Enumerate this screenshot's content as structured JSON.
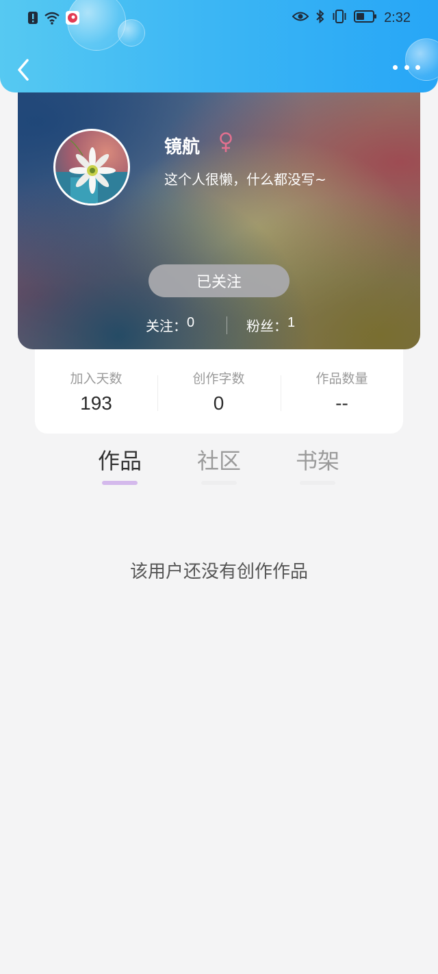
{
  "status_bar": {
    "time": "2:32",
    "icons_left": [
      "alert-icon",
      "wifi-icon",
      "app-notification-icon"
    ],
    "icons_right": [
      "eye-icon",
      "bluetooth-icon",
      "vibrate-icon",
      "battery-icon"
    ]
  },
  "navigation": {
    "back_icon": "chevron-left-icon",
    "more_icon": "more-dots-icon"
  },
  "profile": {
    "username": "镜航",
    "gender_icon": "female-icon",
    "bio": "这个人很懒，什么都没写~",
    "follow_button": "已关注",
    "following_label": "关注：",
    "following_count": "0",
    "followers_label": "粉丝：",
    "followers_count": "1"
  },
  "stats": [
    {
      "label": "加入天数",
      "value": "193"
    },
    {
      "label": "创作字数",
      "value": "0"
    },
    {
      "label": "作品数量",
      "value": "--"
    }
  ],
  "tabs": [
    {
      "label": "作品",
      "active": true
    },
    {
      "label": "社区",
      "active": false
    },
    {
      "label": "书架",
      "active": false
    }
  ],
  "empty_message": "该用户还没有创作作品",
  "colors": {
    "header_gradient_start": "#56c9f2",
    "header_gradient_end": "#27a6f6",
    "gender_color": "#e2708f",
    "tab_indicator_active": "#d4b9ec",
    "tab_indicator_inactive": "#eeeeef",
    "page_background": "#f4f4f5"
  }
}
